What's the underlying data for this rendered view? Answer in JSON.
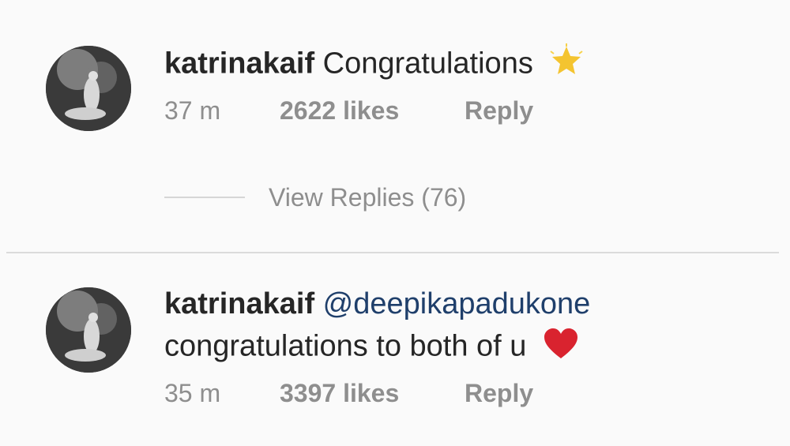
{
  "comments": [
    {
      "username": "katrinakaif",
      "text": "Congratulations",
      "emoji": "star-emoji",
      "time": "37 m",
      "likes": "2622 likes",
      "reply": "Reply",
      "view_replies": "View Replies (76)"
    },
    {
      "username": "katrinakaif",
      "mention": "@deepikapadukone",
      "text": "congratulations to both of u",
      "emoji": "heart-emoji",
      "time": "35 m",
      "likes": "3397 likes",
      "reply": "Reply"
    }
  ],
  "colors": {
    "background": "#fafafa",
    "username": "#262626",
    "mention": "#1f3f6b",
    "meta": "#8e8e8e",
    "heart": "#d9232f",
    "star": "#f4c430"
  }
}
